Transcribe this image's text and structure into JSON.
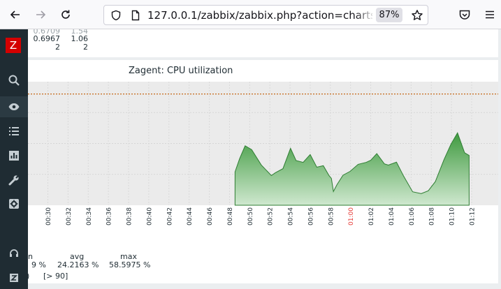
{
  "browser": {
    "url": "127.0.0.1/zabbix/zabbix.php?action=charts.vie",
    "zoom": "87%"
  },
  "top_card": {
    "rows": [
      {
        "a": "0.6709",
        "b": "1.54"
      },
      {
        "a": "0.6967",
        "b": "1.06"
      },
      {
        "a": "2",
        "b": "2"
      }
    ]
  },
  "chart": {
    "title": "Zagent: CPU utilization",
    "legend_headers": {
      "min": "n",
      "avg": "avg",
      "max": "max"
    },
    "legend_values": {
      "min": "9 %",
      "avg": "24.2163 %",
      "max": "58.5975 %"
    },
    "trigger_left": ")",
    "trigger_text": "[> 90]"
  },
  "chart_data": {
    "type": "area",
    "title": "Zagent: CPU utilization",
    "x_tick_labels": [
      "00:30",
      "00:32",
      "00:34",
      "00:36",
      "00:38",
      "00:40",
      "00:42",
      "00:44",
      "00:46",
      "00:48",
      "00:50",
      "00:52",
      "00:54",
      "00:56",
      "00:58",
      "01:00",
      "01:02",
      "01:04",
      "01:06",
      "01:08",
      "01:10",
      "01:12"
    ],
    "highlight_tick": "01:00",
    "trigger_line": 90,
    "ylim": [
      0,
      100
    ],
    "x_minutes": [
      48.55,
      49.0,
      49.55,
      50.2,
      51.15,
      52.15,
      52.55,
      53.3,
      54.05,
      54.6,
      55.3,
      56.0,
      56.65,
      57.3,
      57.85,
      58.1,
      58.3,
      58.65,
      59.25,
      59.95,
      60.75,
      61.55,
      62.0,
      62.6,
      63.35,
      63.75,
      64.55,
      65.25,
      66.15,
      67.0,
      67.7,
      68.4,
      69.25,
      69.95,
      70.6,
      71.3,
      71.75
    ],
    "values": [
      27.0,
      37.6,
      48.1,
      45.0,
      32.6,
      24.0,
      26.3,
      29.6,
      46.1,
      36.2,
      34.7,
      41.0,
      30.8,
      32.0,
      24.2,
      21.7,
      11.1,
      16.6,
      24.3,
      27.4,
      33.1,
      34.7,
      36.4,
      41.8,
      33.5,
      32.5,
      34.9,
      23.7,
      10.9,
      9.4,
      11.7,
      19.1,
      36.7,
      49.4,
      58.6,
      42.5,
      40.3
    ]
  }
}
